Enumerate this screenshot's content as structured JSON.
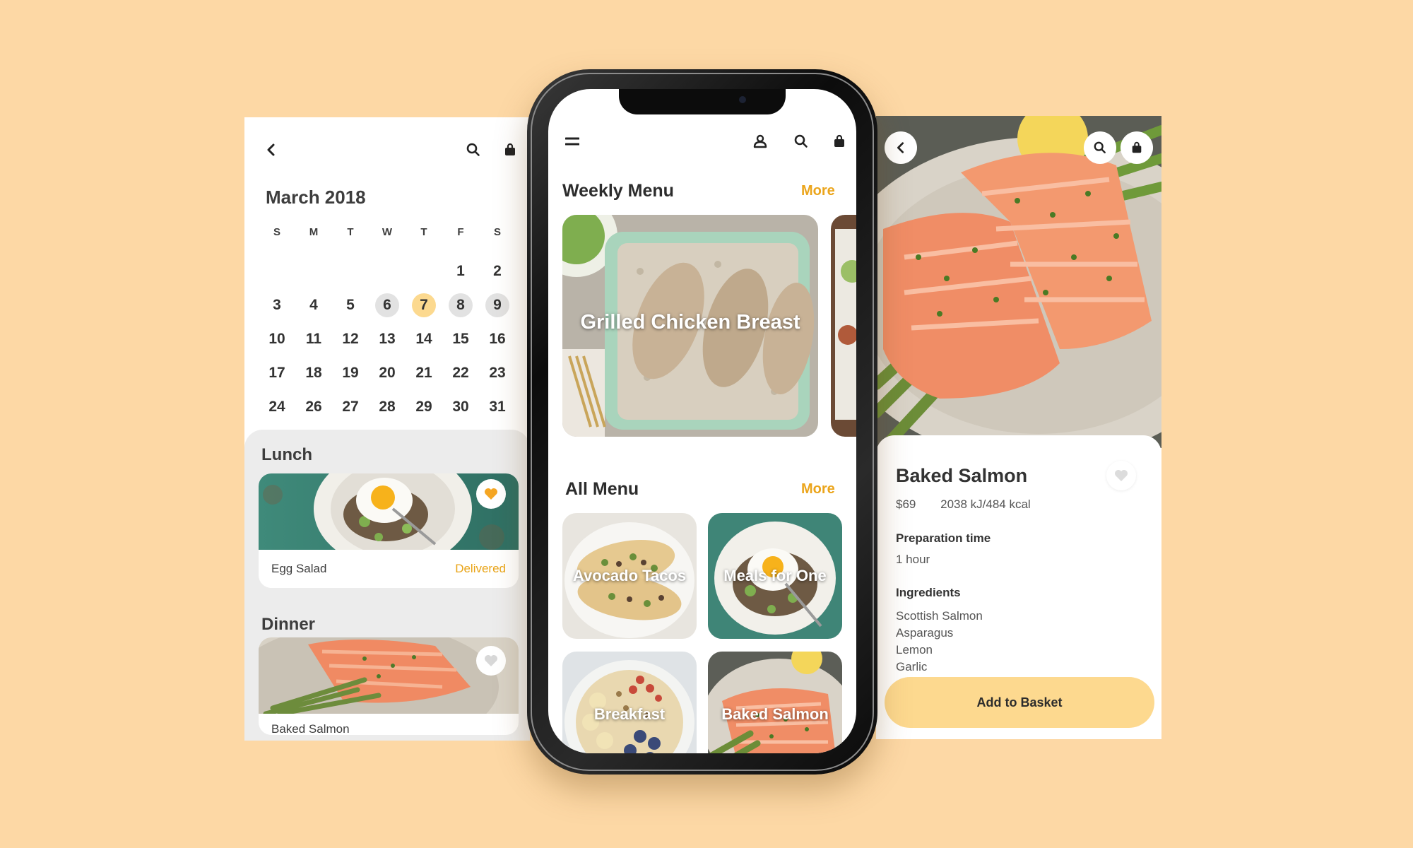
{
  "left": {
    "month_title": "March 2018",
    "weekdays": [
      "S",
      "M",
      "T",
      "W",
      "T",
      "F",
      "S"
    ],
    "days": [
      "",
      "",
      "",
      "",
      "",
      "1",
      "2",
      "3",
      "4",
      "5",
      "6",
      "7",
      "8",
      "9",
      "10",
      "11",
      "12",
      "13",
      "14",
      "15",
      "16",
      "17",
      "18",
      "19",
      "20",
      "21",
      "22",
      "23",
      "24",
      "26",
      "27",
      "28",
      "29",
      "30",
      "31"
    ],
    "highlighted_days": [
      "6",
      "8",
      "9"
    ],
    "today": "7",
    "lunch": {
      "title": "Lunch",
      "item": "Egg Salad",
      "status": "Delivered",
      "favorite": true
    },
    "dinner": {
      "title": "Dinner",
      "item": "Baked Salmon",
      "favorite": false
    }
  },
  "phone": {
    "weekly": {
      "title": "Weekly Menu",
      "more": "More",
      "featured": "Grilled Chicken Breast"
    },
    "all": {
      "title": "All Menu",
      "more": "More",
      "items": [
        "Avocado Tacos",
        "Meals for One",
        "Breakfast",
        "Baked Salmon"
      ]
    }
  },
  "detail": {
    "title": "Baked Salmon",
    "price": "$69",
    "energy": "2038 kJ/484 kcal",
    "prep_label": "Preparation time",
    "prep_value": "1 hour",
    "ingredients_label": "Ingredients",
    "ingredients": [
      "Scottish Salmon",
      "Asparagus",
      "Lemon",
      "Garlic"
    ],
    "cta": "Add to Basket"
  },
  "colors": {
    "background": "#fdd8a5",
    "accent": "#eba51c",
    "today": "#fcd98f",
    "button": "#fdd98f"
  },
  "icons": [
    "back-arrow-icon",
    "search-icon",
    "bag-icon",
    "menu-icon",
    "user-icon",
    "heart-icon"
  ]
}
